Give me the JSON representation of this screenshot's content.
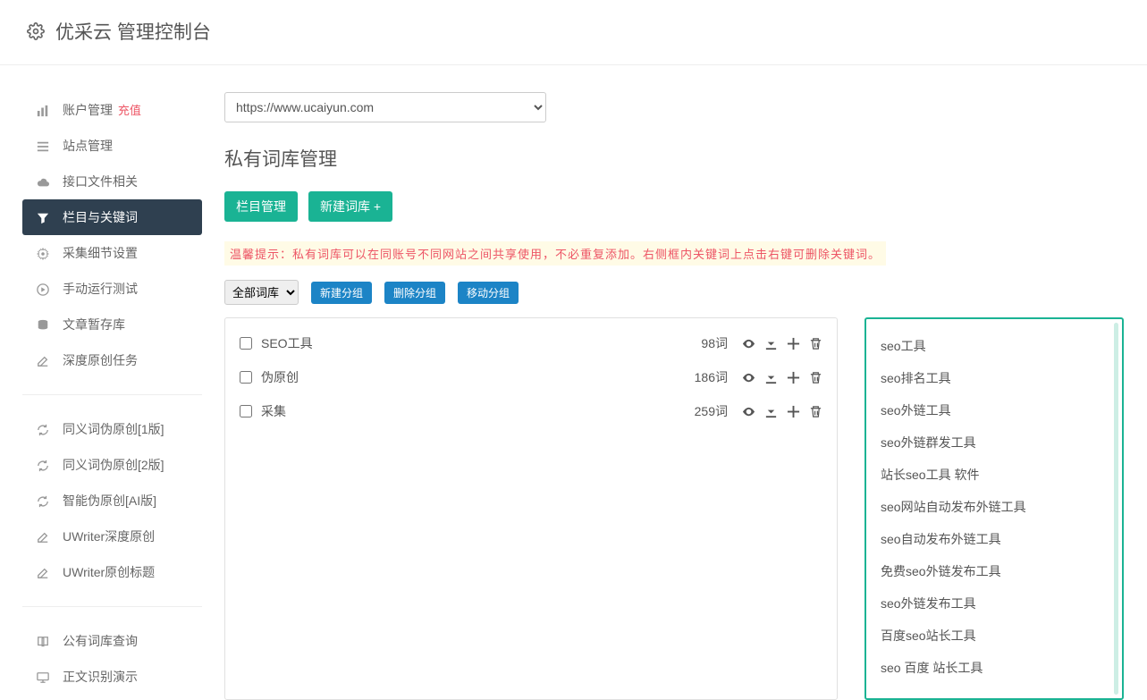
{
  "header": {
    "title": "优采云 管理控制台"
  },
  "sidebar": {
    "group1": [
      {
        "icon": "chart",
        "label": "账户管理",
        "badge": "充值"
      },
      {
        "icon": "list",
        "label": "站点管理"
      },
      {
        "icon": "cloud",
        "label": "接口文件相关"
      },
      {
        "icon": "filter",
        "label": "栏目与关键词",
        "active": true
      },
      {
        "icon": "gears",
        "label": "采集细节设置"
      },
      {
        "icon": "play",
        "label": "手动运行测试"
      },
      {
        "icon": "db",
        "label": "文章暂存库"
      },
      {
        "icon": "edit",
        "label": "深度原创任务"
      }
    ],
    "group2": [
      {
        "icon": "refresh",
        "label": "同义词伪原创[1版]"
      },
      {
        "icon": "refresh",
        "label": "同义词伪原创[2版]"
      },
      {
        "icon": "refresh",
        "label": "智能伪原创[AI版]"
      },
      {
        "icon": "edit",
        "label": "UWriter深度原创"
      },
      {
        "icon": "edit",
        "label": "UWriter原创标题"
      }
    ],
    "group3": [
      {
        "icon": "book",
        "label": "公有词库查询"
      },
      {
        "icon": "monitor",
        "label": "正文识别演示"
      }
    ]
  },
  "main": {
    "site_select": "https://www.ucaiyun.com",
    "page_title": "私有词库管理",
    "btn_category": "栏目管理",
    "btn_new_lexicon": "新建词库 +",
    "tip": "温馨提示：私有词库可以在同账号不同网站之间共享使用，不必重复添加。右侧框内关键词上点击右键可删除关键词。",
    "group_select": "全部词库",
    "btn_new_group": "新建分组",
    "btn_del_group": "删除分组",
    "btn_move_group": "移动分组",
    "lexicons": [
      {
        "name": "SEO工具",
        "count": "98词"
      },
      {
        "name": "伪原创",
        "count": "186词"
      },
      {
        "name": "采集",
        "count": "259词"
      }
    ],
    "keywords": [
      "seo工具",
      "seo排名工具",
      "seo外链工具",
      "seo外链群发工具",
      "站长seo工具 软件",
      "seo网站自动发布外链工具",
      "seo自动发布外链工具",
      "免费seo外链发布工具",
      "seo外链发布工具",
      "百度seo站长工具",
      "seo 百度 站长工具"
    ]
  }
}
